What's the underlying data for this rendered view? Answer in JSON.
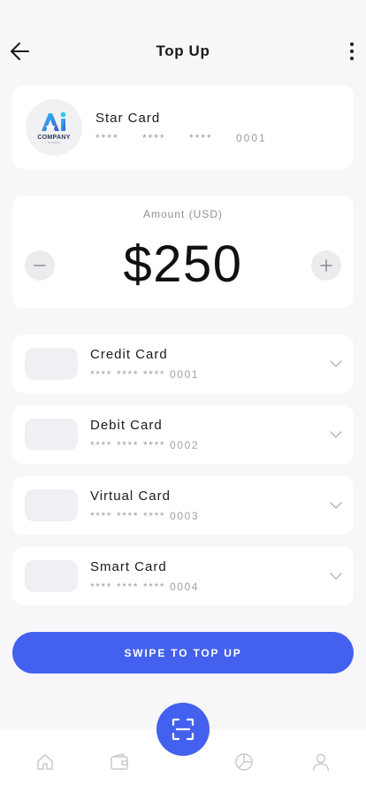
{
  "header": {
    "title": "Top Up",
    "back_icon": "arrow-left-icon",
    "more_icon": "more-vertical-icon"
  },
  "star_card": {
    "logo_mark": "Ai",
    "logo_text": "COMPANY",
    "logo_sub": "SLOGAN",
    "name": "Star Card",
    "mask_1": "****",
    "mask_2": "****",
    "mask_3": "****",
    "last4": "0001"
  },
  "amount": {
    "label": "Amount (USD)",
    "value": "$250",
    "minus_icon": "minus-icon",
    "plus_icon": "plus-icon"
  },
  "methods": [
    {
      "name": "Credit Card",
      "number": "**** **** **** 0001"
    },
    {
      "name": "Debit Card",
      "number": "**** **** **** 0002"
    },
    {
      "name": "Virtual Card",
      "number": "**** **** **** 0003"
    },
    {
      "name": "Smart Card",
      "number": "**** **** **** 0004"
    }
  ],
  "cta": {
    "label": "SWIPE TO TOP UP"
  },
  "nav": {
    "items": [
      "home-icon",
      "wallet-icon",
      "scan-icon",
      "pie-chart-icon",
      "user-icon"
    ]
  },
  "colors": {
    "accent": "#4361ee",
    "background": "#f7f7f9",
    "card": "#ffffff",
    "muted_text": "#9a9aa4"
  }
}
